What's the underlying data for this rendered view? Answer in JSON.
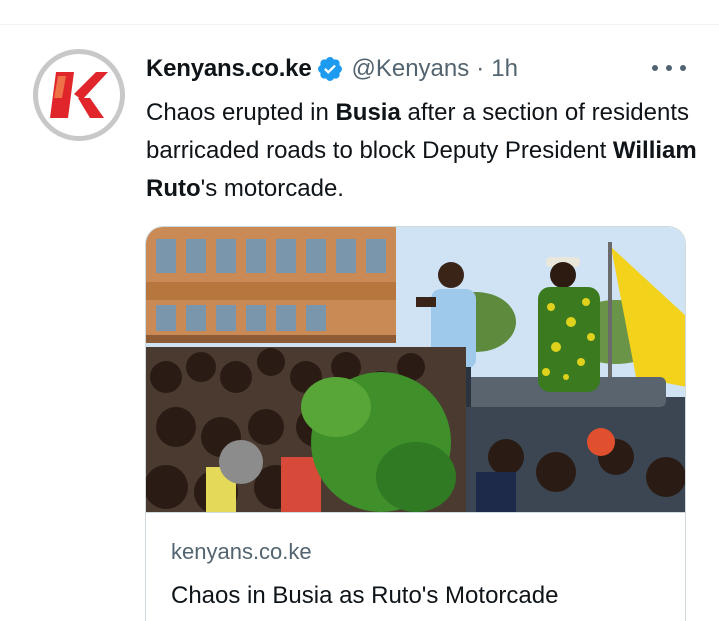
{
  "tweet": {
    "display_name": "Kenyans.co.ke",
    "handle": "@Kenyans",
    "separator": "·",
    "time": "1h",
    "text_segments": [
      {
        "text": "Chaos erupted in ",
        "bold": false
      },
      {
        "text": "Busia",
        "bold": true
      },
      {
        "text": " after a section of residents barricaded roads to block Deputy President ",
        "bold": false
      },
      {
        "text": "William Ruto",
        "bold": true
      },
      {
        "text": "'s motorcade.",
        "bold": false
      }
    ],
    "avatar_letter": "K",
    "verified_icon": "verified-badge-icon",
    "more_icon": "more-dots-icon"
  },
  "card": {
    "domain": "kenyans.co.ke",
    "title": "Chaos in Busia as Ruto's Motorcade"
  },
  "colors": {
    "accent_blue": "#1d9bf0",
    "brand_red": "#e0262b",
    "secondary_text": "#536471",
    "border": "#cfd9de"
  }
}
